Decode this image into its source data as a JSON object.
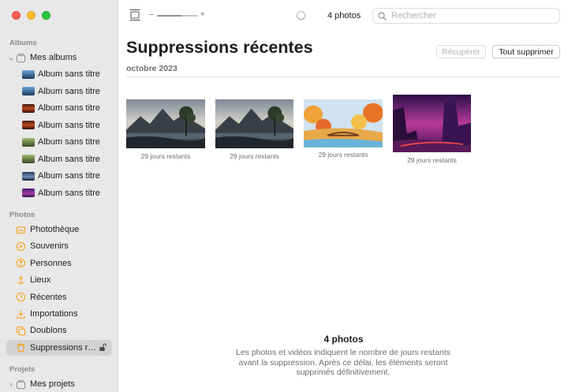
{
  "sidebar": {
    "section_albums": "Albums",
    "my_albums": "Mes albums",
    "albums": [
      {
        "label": "Album sans titre",
        "thumb": "sea-blue"
      },
      {
        "label": "Album sans titre",
        "thumb": "sea-blue"
      },
      {
        "label": "Album sans titre",
        "thumb": "sunset-red"
      },
      {
        "label": "Album sans titre",
        "thumb": "sunset-red"
      },
      {
        "label": "Album sans titre",
        "thumb": "green-field"
      },
      {
        "label": "Album sans titre",
        "thumb": "green-field"
      },
      {
        "label": "Album sans titre",
        "thumb": "night-blue"
      },
      {
        "label": "Album sans titre",
        "thumb": "violet"
      }
    ],
    "section_photos": "Photos",
    "photos_items": [
      {
        "label": "Photothèque",
        "icon": "photo-library-icon"
      },
      {
        "label": "Souvenirs",
        "icon": "memories-icon"
      },
      {
        "label": "Personnes",
        "icon": "people-icon"
      },
      {
        "label": "Lieux",
        "icon": "places-icon"
      },
      {
        "label": "Récentes",
        "icon": "recents-icon"
      },
      {
        "label": "Importations",
        "icon": "imports-icon"
      },
      {
        "label": "Doublons",
        "icon": "duplicates-icon"
      },
      {
        "label": "Suppressions ré...",
        "icon": "trash-icon"
      }
    ],
    "section_projects": "Projets",
    "my_projects": "Mes projets"
  },
  "toolbar": {
    "zoom_minus": "–",
    "zoom_plus": "+",
    "zoom_level": 0.6,
    "photo_count": "4 photos",
    "search_placeholder": "Rechercher"
  },
  "header": {
    "title": "Suppressions récentes",
    "subtitle": "octobre 2023",
    "recover_label": "Récupérer",
    "delete_all_label": "Tout supprimer"
  },
  "photos": [
    {
      "days_left": "29 jours restants",
      "scene": "mountain-lake"
    },
    {
      "days_left": "29 jours restants",
      "scene": "mountain-lake"
    },
    {
      "days_left": "29 jours restants",
      "scene": "autumn-bridge"
    },
    {
      "days_left": "29 jours restants",
      "scene": "purple-canyon"
    }
  ],
  "footer": {
    "title": "4 photos",
    "text": "Les photos et vidéos indiquent le nombre de jours restants avant la suppression. Après ce délai, les éléments seront supprimés définitivement."
  },
  "colors": {
    "accent": "#f5a623",
    "sidebar_bg": "#e9e8e8",
    "selected_bg": "#d3d3d3"
  }
}
